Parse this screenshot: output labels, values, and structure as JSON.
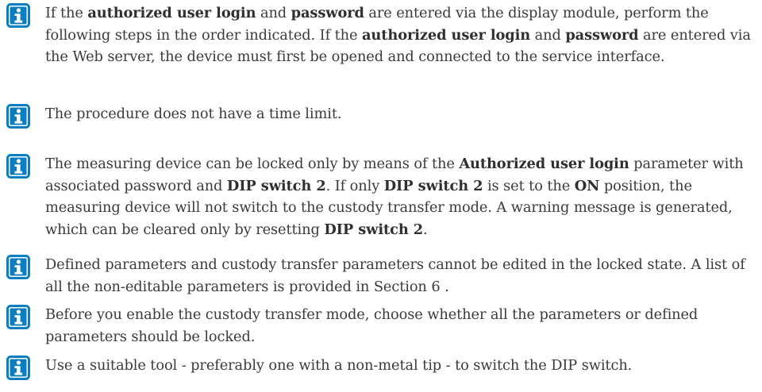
{
  "notes": [
    {
      "icon": "info-icon",
      "segments": [
        {
          "text": "If the ",
          "bold": false
        },
        {
          "text": "authorized user login",
          "bold": true
        },
        {
          "text": " and ",
          "bold": false
        },
        {
          "text": "password",
          "bold": true
        },
        {
          "text": " are entered via the display module, perform the following steps in the order indicated. If the ",
          "bold": false
        },
        {
          "text": "authorized user login",
          "bold": true
        },
        {
          "text": " and ",
          "bold": false
        },
        {
          "text": "password",
          "bold": true
        },
        {
          "text": " are entered via the Web server, the device must first be opened and connected to the service interface.",
          "bold": false
        }
      ]
    },
    {
      "icon": "info-icon",
      "segments": [
        {
          "text": "The procedure does not have a time limit.",
          "bold": false
        }
      ]
    },
    {
      "icon": "info-icon",
      "segments": [
        {
          "text": "The measuring device can be locked only by means of the ",
          "bold": false
        },
        {
          "text": "Authorized user login",
          "bold": true
        },
        {
          "text": " parameter with associated password and ",
          "bold": false
        },
        {
          "text": "DIP switch 2",
          "bold": true
        },
        {
          "text": ". If only ",
          "bold": false
        },
        {
          "text": "DIP switch 2",
          "bold": true
        },
        {
          "text": " is set to the ",
          "bold": false
        },
        {
          "text": "ON",
          "bold": true
        },
        {
          "text": " position, the measuring device will not switch to the custody transfer mode. A warning message is generated, which can be cleared only by resetting ",
          "bold": false
        },
        {
          "text": "DIP switch 2",
          "bold": true
        },
        {
          "text": ".",
          "bold": false
        }
      ]
    },
    {
      "icon": "info-icon",
      "segments": [
        {
          "text": "Defined parameters and custody transfer parameters cannot be edited in the locked state. A list of all the non-editable parameters is provided in Section 6 .",
          "bold": false
        }
      ]
    },
    {
      "icon": "info-icon",
      "segments": [
        {
          "text": "Before you enable the custody transfer mode, choose whether all the parameters or defined parameters should be locked.",
          "bold": false
        }
      ]
    },
    {
      "icon": "info-icon",
      "segments": [
        {
          "text": "Use a suitable tool - preferably one with a non-metal tip - to switch the DIP switch.",
          "bold": false
        }
      ]
    }
  ],
  "colors": {
    "icon_blue": "#0b7ec2",
    "text": "#3a3a3a"
  }
}
